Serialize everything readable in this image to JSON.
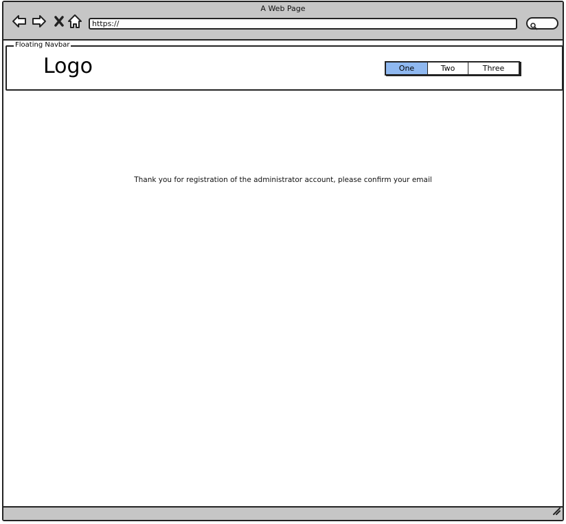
{
  "window": {
    "title": "A Web Page",
    "url": "https://"
  },
  "navbar": {
    "group_label": "Floating Navbar",
    "logo": "Logo",
    "tabs": [
      {
        "label": "One",
        "active": true
      },
      {
        "label": "Two",
        "active": false
      },
      {
        "label": "Three",
        "active": false
      }
    ]
  },
  "main": {
    "message": "Thank you for registration of the administrator account, please confirm your email"
  },
  "icons": {
    "back": "back-arrow-icon",
    "forward": "forward-arrow-icon",
    "stop": "close-icon",
    "home": "home-icon",
    "search": "search-icon",
    "resize": "resize-grip-icon"
  },
  "colors": {
    "chrome": "#c6c6c6",
    "active_tab": "#8fb8f0"
  }
}
